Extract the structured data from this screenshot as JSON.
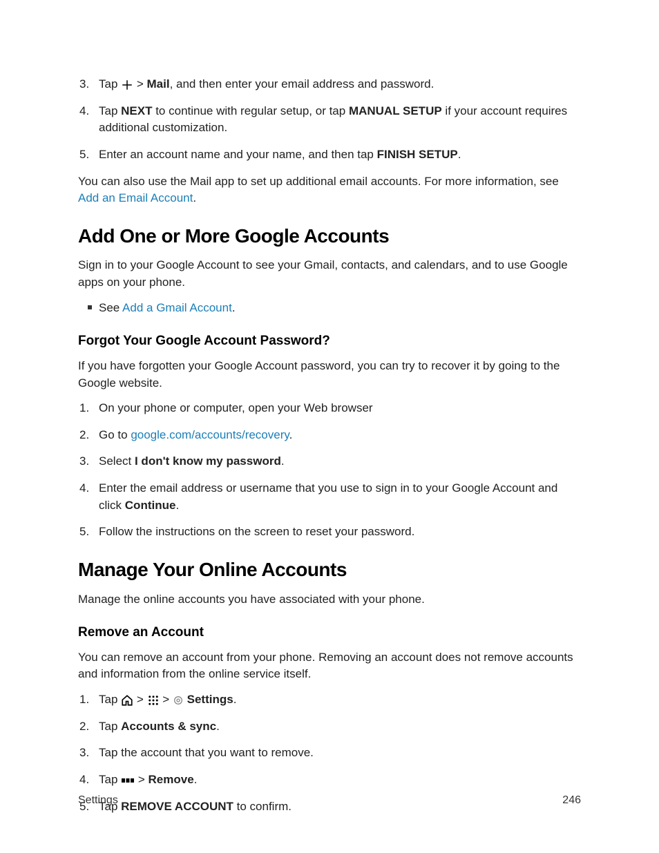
{
  "topList": {
    "item3_pre": "Tap ",
    "item3_sep": " > ",
    "item3_bold": "Mail",
    "item3_post": ", and then enter your email address and password.",
    "item4_pre": "Tap ",
    "item4_b1": "NEXT",
    "item4_mid": " to continue with regular setup, or tap ",
    "item4_b2": "MANUAL SETUP",
    "item4_post": " if your account requires additional customization.",
    "item5_pre": "Enter an account name and your name, and then tap ",
    "item5_b": "FINISH SETUP",
    "item5_post": "."
  },
  "topPara": {
    "pre": "You can also use the Mail app to set up additional email accounts. For more information, see ",
    "link": "Add an Email Account",
    "post": "."
  },
  "h1a": "Add One or More Google Accounts",
  "p1a": "Sign in to your Google Account to see your Gmail, contacts, and calendars, and to use Google apps on your phone.",
  "bullet1_pre": "See ",
  "bullet1_link": "Add a Gmail Account",
  "bullet1_post": ".",
  "h2a": "Forgot Your Google Account Password?",
  "p2a": "If you have forgotten your Google Account password, you can try to recover it by going to the Google website.",
  "listA": {
    "i1": "On your phone or computer, open your Web browser",
    "i2_pre": "Go to ",
    "i2_link": "google.com/accounts/recovery",
    "i2_post": ".",
    "i3_pre": "Select ",
    "i3_b": "I don't know my password",
    "i3_post": ".",
    "i4_pre": "Enter the email address or username that you use to sign in to your Google Account and click ",
    "i4_b": "Continue",
    "i4_post": ".",
    "i5": "Follow the instructions on the screen to reset your password."
  },
  "h1b": "Manage Your Online Accounts",
  "p1b": "Manage the online accounts you have associated with your phone.",
  "h2b": "Remove an Account",
  "p2b": "You can remove an account from your phone. Removing an account does not remove accounts and information from the online service itself.",
  "listB": {
    "i1_pre": "Tap ",
    "i1_sep": " > ",
    "i1_b": "Settings",
    "i1_post": ".",
    "i2_pre": "Tap ",
    "i2_b": "Accounts & sync",
    "i2_post": ".",
    "i3": "Tap the account that you want to remove.",
    "i4_pre": "Tap ",
    "i4_sep": " > ",
    "i4_b": "Remove",
    "i4_post": ".",
    "i5_pre": "Tap ",
    "i5_b": "REMOVE ACCOUNT",
    "i5_post": " to confirm."
  },
  "footer": {
    "left": "Settings",
    "right": "246"
  }
}
